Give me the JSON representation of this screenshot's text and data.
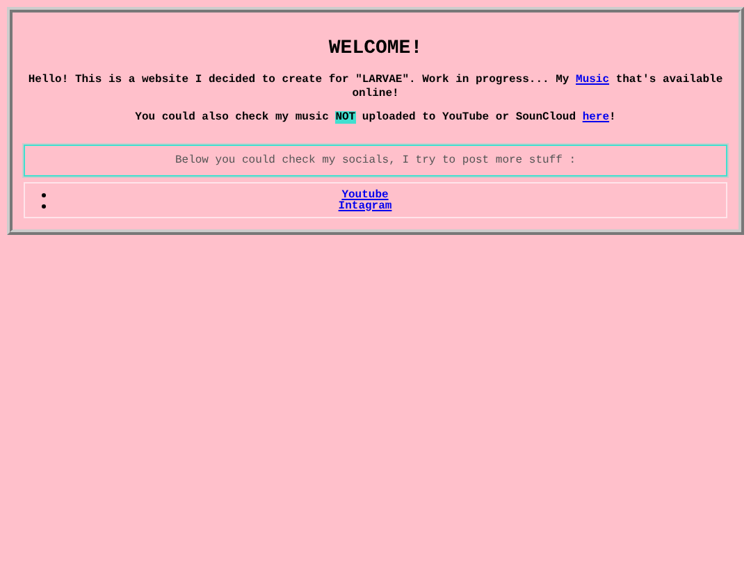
{
  "title": "WELCOME!",
  "intro": {
    "before": "Hello! This is a website I decided to create for \"LARVAE\". Work in progress... My ",
    "link": "Music",
    "after": " that's available online!"
  },
  "note": {
    "before": "You could also check my music ",
    "highlight": "NOT",
    "middle": " uploaded to YouTube or SounCloud ",
    "link": "here",
    "after": "!"
  },
  "socials_heading": "Below you could check my socials, I try to post more stuff :",
  "socials": [
    {
      "label": "Youtube"
    },
    {
      "label": "Intagram"
    }
  ]
}
